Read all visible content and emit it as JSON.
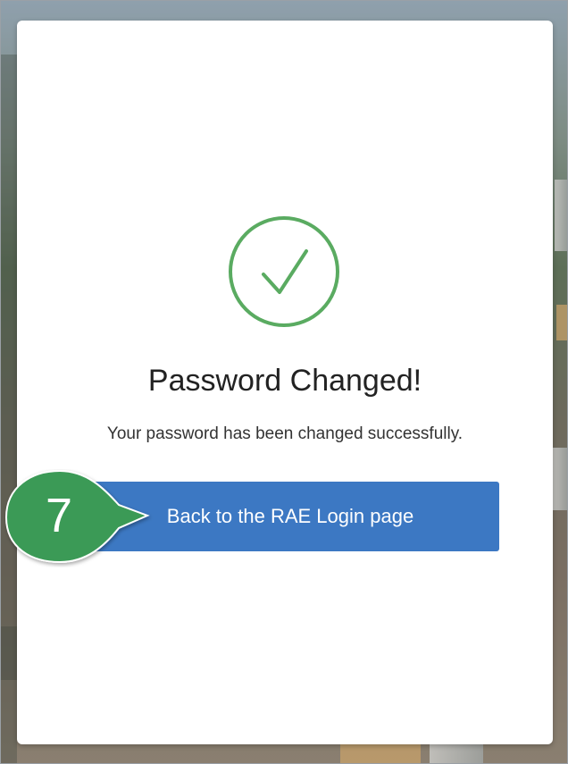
{
  "dialog": {
    "title": "Password Changed!",
    "message": "Your password has been changed successfully.",
    "back_button_label": "Back to the RAE Login page"
  },
  "callout": {
    "step": "7"
  },
  "icons": {
    "status": "check-circle-icon"
  },
  "colors": {
    "success_green": "#5aab61",
    "button_blue": "#3c78c3",
    "callout_green": "#3a9a57",
    "card_background": "#ffffff"
  }
}
